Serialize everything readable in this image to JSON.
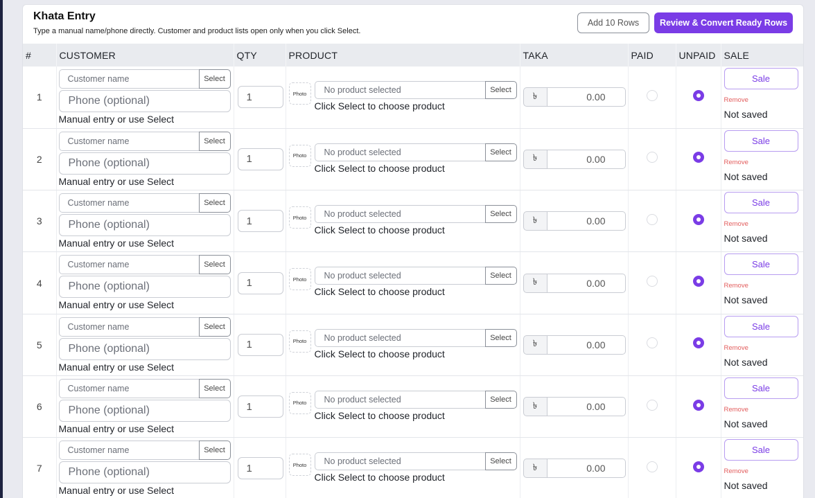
{
  "header": {
    "title": "Khata Entry",
    "subtitle": "Type a manual name/phone directly. Customer and product lists open only when you click Select.",
    "add_rows_label": "Add 10 Rows",
    "review_label": "Review & Convert Ready Rows"
  },
  "columns": [
    "#",
    "CUSTOMER",
    "QTY",
    "PRODUCT",
    "TAKA",
    "PAID",
    "UNPAID",
    "SALE"
  ],
  "colors": {
    "accent": "#7a3ce6",
    "remove": "#e25c5c"
  },
  "rows": [
    {
      "num": "1",
      "name_placeholder": "Customer name",
      "select": "Select",
      "phone_placeholder": "Phone (optional)",
      "hint": "Manual entry or use Select",
      "qty": "1",
      "photo": "Photo",
      "product_placeholder": "No product selected",
      "product_select": "Select",
      "product_hint": "Click Select to choose product",
      "taka_symbol": "৳",
      "taka": "0.00",
      "paid": false,
      "unpaid": true,
      "sale_label": "Sale",
      "remove_label": "Remove",
      "status": "Not saved"
    },
    {
      "num": "2",
      "name_placeholder": "Customer name",
      "select": "Select",
      "phone_placeholder": "Phone (optional)",
      "hint": "Manual entry or use Select",
      "qty": "1",
      "photo": "Photo",
      "product_placeholder": "No product selected",
      "product_select": "Select",
      "product_hint": "Click Select to choose product",
      "taka_symbol": "৳",
      "taka": "0.00",
      "paid": false,
      "unpaid": true,
      "sale_label": "Sale",
      "remove_label": "Remove",
      "status": "Not saved"
    },
    {
      "num": "3",
      "name_placeholder": "Customer name",
      "select": "Select",
      "phone_placeholder": "Phone (optional)",
      "hint": "Manual entry or use Select",
      "qty": "1",
      "photo": "Photo",
      "product_placeholder": "No product selected",
      "product_select": "Select",
      "product_hint": "Click Select to choose product",
      "taka_symbol": "৳",
      "taka": "0.00",
      "paid": false,
      "unpaid": true,
      "sale_label": "Sale",
      "remove_label": "Remove",
      "status": "Not saved"
    },
    {
      "num": "4",
      "name_placeholder": "Customer name",
      "select": "Select",
      "phone_placeholder": "Phone (optional)",
      "hint": "Manual entry or use Select",
      "qty": "1",
      "photo": "Photo",
      "product_placeholder": "No product selected",
      "product_select": "Select",
      "product_hint": "Click Select to choose product",
      "taka_symbol": "৳",
      "taka": "0.00",
      "paid": false,
      "unpaid": true,
      "sale_label": "Sale",
      "remove_label": "Remove",
      "status": "Not saved"
    },
    {
      "num": "5",
      "name_placeholder": "Customer name",
      "select": "Select",
      "phone_placeholder": "Phone (optional)",
      "hint": "Manual entry or use Select",
      "qty": "1",
      "photo": "Photo",
      "product_placeholder": "No product selected",
      "product_select": "Select",
      "product_hint": "Click Select to choose product",
      "taka_symbol": "৳",
      "taka": "0.00",
      "paid": false,
      "unpaid": true,
      "sale_label": "Sale",
      "remove_label": "Remove",
      "status": "Not saved"
    },
    {
      "num": "6",
      "name_placeholder": "Customer name",
      "select": "Select",
      "phone_placeholder": "Phone (optional)",
      "hint": "Manual entry or use Select",
      "qty": "1",
      "photo": "Photo",
      "product_placeholder": "No product selected",
      "product_select": "Select",
      "product_hint": "Click Select to choose product",
      "taka_symbol": "৳",
      "taka": "0.00",
      "paid": false,
      "unpaid": true,
      "sale_label": "Sale",
      "remove_label": "Remove",
      "status": "Not saved"
    },
    {
      "num": "7",
      "name_placeholder": "Customer name",
      "select": "Select",
      "phone_placeholder": "Phone (optional)",
      "hint": "Manual entry or use Select",
      "qty": "1",
      "photo": "Photo",
      "product_placeholder": "No product selected",
      "product_select": "Select",
      "product_hint": "Click Select to choose product",
      "taka_symbol": "৳",
      "taka": "0.00",
      "paid": false,
      "unpaid": true,
      "sale_label": "Sale",
      "remove_label": "Remove",
      "status": "Not saved"
    }
  ]
}
